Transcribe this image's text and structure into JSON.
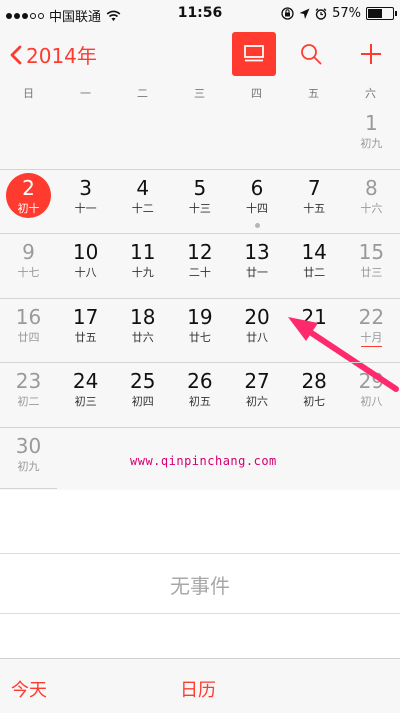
{
  "status_bar": {
    "carrier": "中国联通",
    "time": "11:56",
    "battery": "57%",
    "battery_level": 0.57,
    "signal_bars_filled": 3,
    "signal_bars_total": 5,
    "icons": [
      "wifi-icon",
      "orientation-lock-icon",
      "location-arrow-icon",
      "alarm-icon",
      "battery-icon"
    ]
  },
  "nav": {
    "back_label": "2014年",
    "buttons": [
      "list-view-toggle",
      "search",
      "add-event"
    ],
    "accent_color": "#ff3b30"
  },
  "weekdays": [
    "日",
    "一",
    "二",
    "三",
    "四",
    "五",
    "六"
  ],
  "month_grid": [
    [
      null,
      null,
      null,
      null,
      null,
      null,
      {
        "day": "1",
        "lunar": "初九"
      }
    ],
    [
      {
        "day": "2",
        "lunar": "初十",
        "today": true
      },
      {
        "day": "3",
        "lunar": "十一"
      },
      {
        "day": "4",
        "lunar": "十二"
      },
      {
        "day": "5",
        "lunar": "十三"
      },
      {
        "day": "6",
        "lunar": "十四",
        "event_dot": true
      },
      {
        "day": "7",
        "lunar": "十五"
      },
      {
        "day": "8",
        "lunar": "十六"
      }
    ],
    [
      {
        "day": "9",
        "lunar": "十七"
      },
      {
        "day": "10",
        "lunar": "十八"
      },
      {
        "day": "11",
        "lunar": "十九"
      },
      {
        "day": "12",
        "lunar": "二十"
      },
      {
        "day": "13",
        "lunar": "廿一"
      },
      {
        "day": "14",
        "lunar": "廿二"
      },
      {
        "day": "15",
        "lunar": "廿三"
      }
    ],
    [
      {
        "day": "16",
        "lunar": "廿四"
      },
      {
        "day": "17",
        "lunar": "廿五"
      },
      {
        "day": "18",
        "lunar": "廿六"
      },
      {
        "day": "19",
        "lunar": "廿七"
      },
      {
        "day": "20",
        "lunar": "廿八"
      },
      {
        "day": "21",
        "lunar": ""
      },
      {
        "day": "22",
        "lunar": "十月",
        "festival": true
      }
    ],
    [
      {
        "day": "23",
        "lunar": "初二"
      },
      {
        "day": "24",
        "lunar": "初三"
      },
      {
        "day": "25",
        "lunar": "初四"
      },
      {
        "day": "26",
        "lunar": "初五"
      },
      {
        "day": "27",
        "lunar": "初六"
      },
      {
        "day": "28",
        "lunar": "初七"
      },
      {
        "day": "29",
        "lunar": "初八"
      }
    ],
    [
      {
        "day": "30",
        "lunar": "初九"
      },
      null,
      null,
      null,
      null,
      null,
      null
    ]
  ],
  "watermark": "www.qinpinchang.com",
  "events": {
    "empty_label": "无事件"
  },
  "tab_bar": {
    "today_label": "今天",
    "calendar_label": "日历"
  }
}
